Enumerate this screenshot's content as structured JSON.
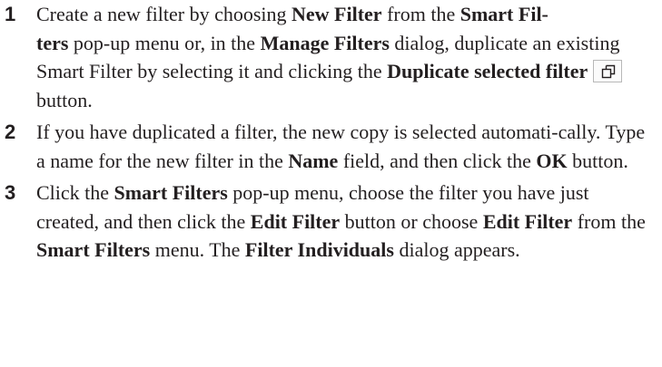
{
  "steps": [
    {
      "number": "1",
      "t1": "Create a new filter by choosing ",
      "b1": "New Filter",
      "t2": " from the ",
      "b2": "Smart Fil-",
      "b3": "ters",
      "t3": " pop-up menu or, in the ",
      "b4": "Manage Filters",
      "t4": " dialog, duplicate an existing Smart Filter by selecting it and clicking the ",
      "b5": "Duplicate selected filter",
      "icon": "duplicate-icon",
      "t5": " button."
    },
    {
      "number": "2",
      "t1": "If you have duplicated a filter, the new copy is selected automati-cally. Type a name for the new filter in the ",
      "b1": "Name",
      "t2": " field, and then click the ",
      "b2": "OK",
      "t3": " button."
    },
    {
      "number": "3",
      "t1": "Click the ",
      "b1": "Smart Filters",
      "t2": " pop-up menu, choose the filter you have just created, and then click the ",
      "b2": "Edit Filter",
      "t3": " button or choose ",
      "b3": "Edit Filter",
      "t4": " from the ",
      "b4": "Smart Filters",
      "t5": " menu. The ",
      "b5": "Filter Individuals",
      "t6": " dialog appears."
    }
  ]
}
